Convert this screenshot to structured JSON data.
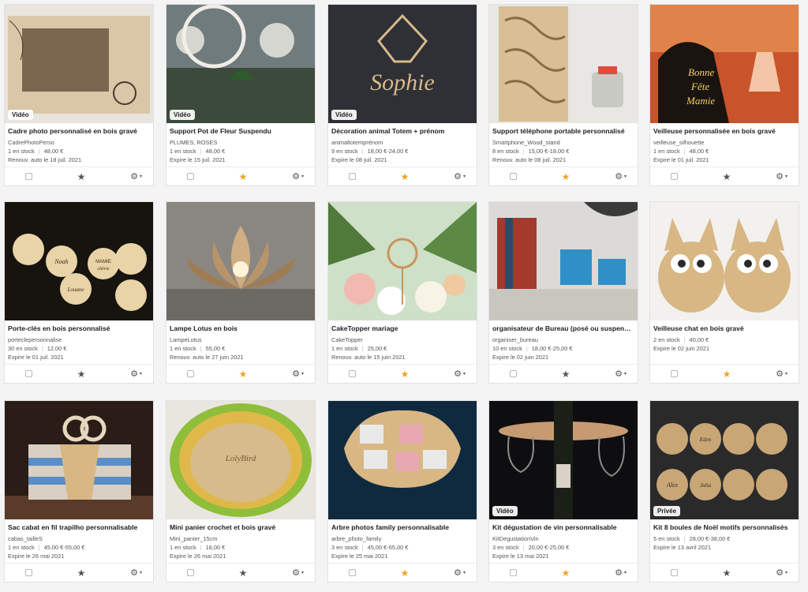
{
  "listings": [
    {
      "title": "Cadre photo personnalisé en bois gravé",
      "sku": "CadrePhotoPerso",
      "stock": "1 en stock",
      "price": "48,00 €",
      "renew": "Renouv. auto le 18 juil. 2021",
      "badge": "Vidéo",
      "favorite": false
    },
    {
      "title": "Support Pot de Fleur Suspendu",
      "sku": "PLUMES, ROSES",
      "stock": "1 en stock",
      "price": "48,00 €",
      "renew": "Expire le 15 juil. 2021",
      "badge": "Vidéo",
      "favorite": true
    },
    {
      "title": "Décoration animal Totem + prénom",
      "sku": "animaltotemprénom",
      "stock": "9 en stock",
      "price": "18,00 €-24,00 €",
      "renew": "Expire le 08 juil. 2021",
      "badge": "Vidéo",
      "favorite": true
    },
    {
      "title": "Support téléphone portable personnalisé",
      "sku": "Smartphone_Wood_stand",
      "stock": "8 en stock",
      "price": "15,00 €-18,00 €",
      "renew": "Renouv. auto le 08 juil. 2021",
      "badge": "",
      "favorite": true
    },
    {
      "title": "Veilleuse personnalisée en bois gravé",
      "sku": "veilleuse_silhouette",
      "stock": "1 en stock",
      "price": "48,00 €",
      "renew": "Expire le 01 juil. 2021",
      "badge": "",
      "favorite": false
    },
    {
      "title": "Porte-clés en bois personnalisé",
      "sku": "porteclepersonnalise",
      "stock": "30 en stock",
      "price": "12,00 €",
      "renew": "Expire le 01 juil. 2021",
      "badge": "",
      "favorite": false
    },
    {
      "title": "Lampe Lotus en bois",
      "sku": "LampeLotus",
      "stock": "1 en stock",
      "price": "55,00 €",
      "renew": "Renouv. auto le 27 juin 2021",
      "badge": "",
      "favorite": true
    },
    {
      "title": "CakeTopper mariage",
      "sku": "CakeTopper",
      "stock": "1 en stock",
      "price": "25,00 €",
      "renew": "Renouv. auto le 15 juin 2021",
      "badge": "",
      "favorite": true
    },
    {
      "title": "organisateur de Bureau (posé ou suspendu)",
      "sku": "organiser_bureau",
      "stock": "10 en stock",
      "price": "18,00 €-25,00 €",
      "renew": "Expire le 02 juin 2021",
      "badge": "",
      "favorite": false
    },
    {
      "title": "Veilleuse chat en bois gravé",
      "sku": "",
      "stock": "2 en stock",
      "price": "40,00 €",
      "renew": "Expire le 02 juin 2021",
      "badge": "",
      "favorite": true
    },
    {
      "title": "Sac cabat en fil trapilho personnalisable",
      "sku": "cabas_tailleS",
      "stock": "1 en stock",
      "price": "45,00 €-55,00 €",
      "renew": "Expire le 26 mai 2021",
      "badge": "",
      "favorite": false
    },
    {
      "title": "Mini panier crochet et bois gravé",
      "sku": "Mini_panier_15cm",
      "stock": "1 en stock",
      "price": "18,00 €",
      "renew": "Expire le 26 mai 2021",
      "badge": "",
      "favorite": false
    },
    {
      "title": "Arbre photos family personnalisable",
      "sku": "arbre_photo_family",
      "stock": "3 en stock",
      "price": "45,00 €-65,00 €",
      "renew": "Expire le 25 mai 2021",
      "badge": "",
      "favorite": true
    },
    {
      "title": "Kit dégustation de vin personnalisable",
      "sku": "KitDegustationVin",
      "stock": "3 en stock",
      "price": "20,00 €-25,00 €",
      "renew": "Expire le 13 mai 2021",
      "badge": "Vidéo",
      "favorite": true
    },
    {
      "title": "Kit 8 boules de Noël motifs personnalisés",
      "sku": "",
      "stock": "5 en stock",
      "price": "28,00 €-38,00 €",
      "renew": "Expire le 13 avril 2021",
      "badge": "Privée",
      "favorite": false
    }
  ],
  "image_labels": {
    "sophie": "Sophie",
    "bonne": "Bonne",
    "fete": "Fête",
    "mamie": "Mamie",
    "noah": "Noah",
    "louane": "Louane",
    "mamie_key": "MAMIE",
    "mamie_key2": "chérie",
    "lolybird": "LolyBird",
    "alex": "Alex",
    "julia": "Julia",
    "eden": "Eden"
  },
  "colors": {
    "star_favorite": "#f1a51f",
    "star_default": "#555555"
  },
  "icons": {
    "star": "★",
    "gear": "⚙",
    "caret": "▾"
  }
}
